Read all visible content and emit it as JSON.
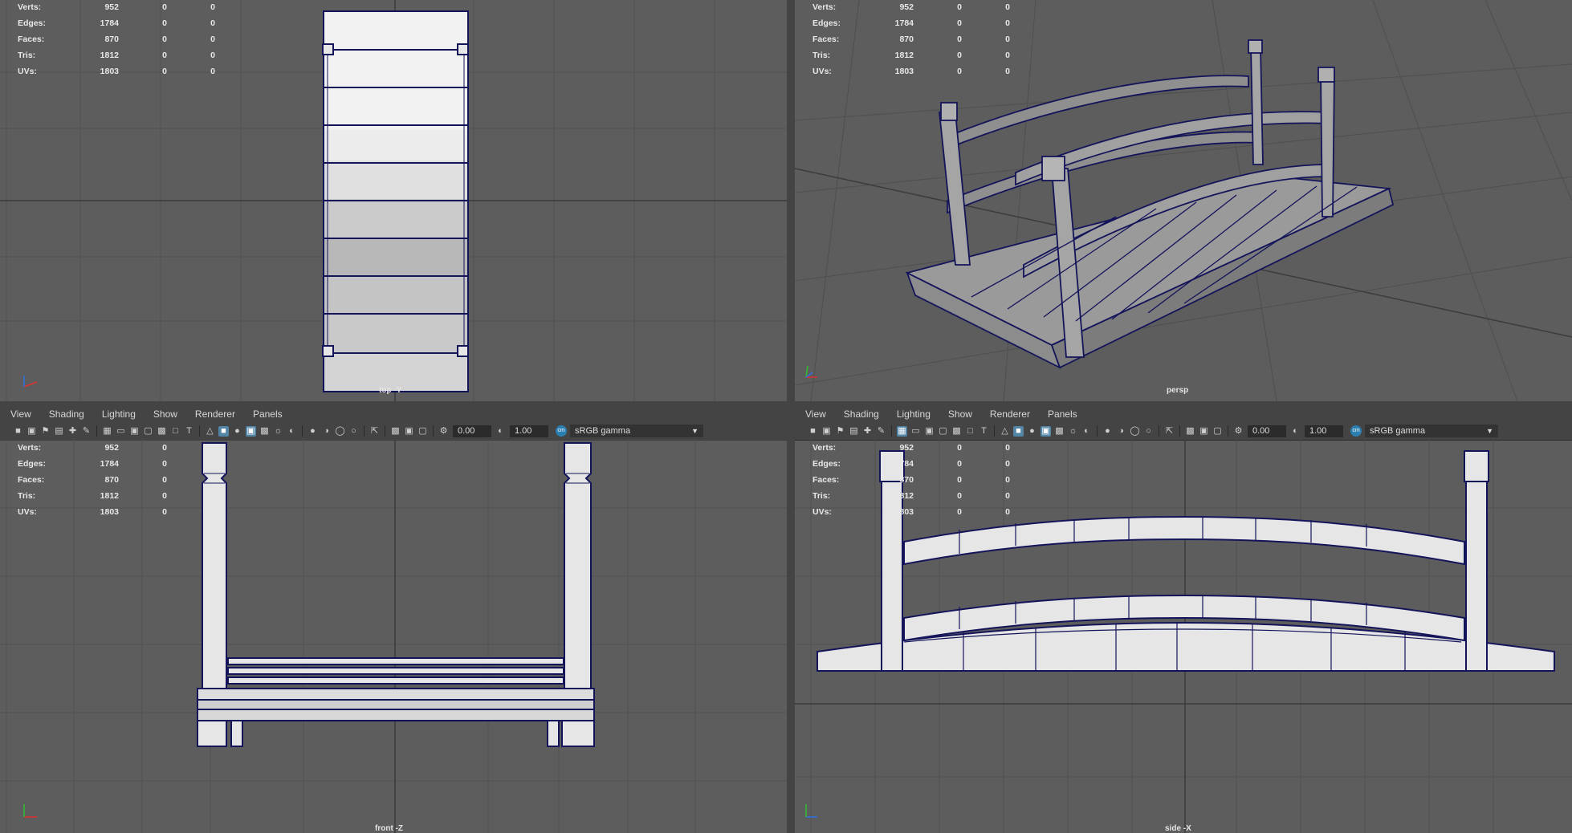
{
  "panel_menu": [
    "View",
    "Shading",
    "Lighting",
    "Show",
    "Renderer",
    "Panels"
  ],
  "hud": {
    "labels": [
      "Verts:",
      "Edges:",
      "Faces:",
      "Tris:",
      "UVs:"
    ],
    "values": [
      "952",
      "1784",
      "870",
      "1812",
      "1803"
    ],
    "sel": "0",
    "comp": "0"
  },
  "toolbar": {
    "exposure": "0.00",
    "gamma": "1.00",
    "color_space": "sRGB gamma"
  },
  "viewports": {
    "top": "top -Y",
    "persp": "persp",
    "front": "front -Z",
    "side": "side -X"
  },
  "colors": {
    "viewport_bg": "#5d5d5d",
    "grid": "#515151",
    "grid_axis": "#3b3b3b",
    "wire": "#14145a",
    "mesh_fill": "#e6e6e6",
    "ui_bg": "#444444",
    "highlight": "#5285a6"
  },
  "icons": [
    "camera-icon",
    "grid-icon",
    "wireframe-icon",
    "smooth-shade-icon",
    "textured-icon",
    "light-icon",
    "xray-icon",
    "isolate-icon",
    "exposure-icon",
    "gamma-icon",
    "color-space-icon"
  ]
}
